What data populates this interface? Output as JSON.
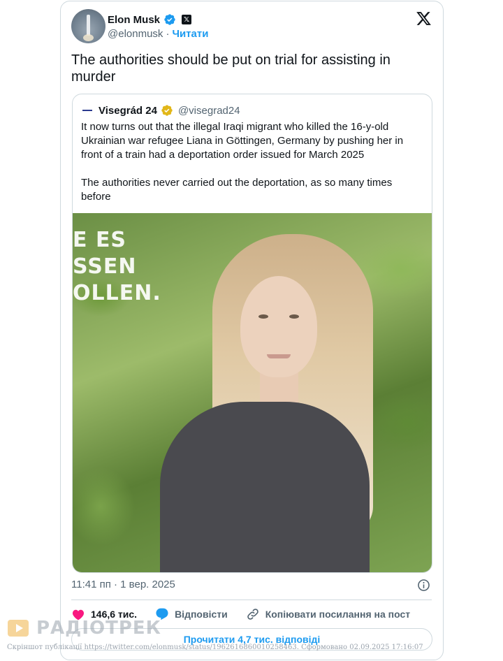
{
  "tweet": {
    "author_name": "Elon Musk",
    "author_handle": "@elonmusk",
    "separator": "·",
    "follow_label": "Читати",
    "x_badge": "𝕏",
    "text": "The authorities should be put on trial for assisting in murder",
    "timestamp": "11:41 пп · 1 вер. 2025"
  },
  "quoted": {
    "name": "Visegrád 24",
    "handle": "@visegrad24",
    "text": "It now turns out that the illegal Iraqi migrant who killed the 16-y-old Ukrainian war refugee Liana in Göttingen, Germany by pushing her in front of a train had a deportation order issued for March 2025\n\nThe authorities never carried out the deportation, as so many times before",
    "image_overlay_text": [
      "E ES",
      "SSEN",
      "OLLEN."
    ]
  },
  "actions": {
    "likes": "146,6 тис.",
    "reply": "Відповісти",
    "copy_link": "Копіювати посилання на пост"
  },
  "read_replies": "Прочитати 4,7 тис. відповіді",
  "watermark": {
    "logo_text": "РАДІОТРЕК",
    "caption": "Скріншот публікації https://twitter.com/elonmusk/status/1962616860010258463. Сформовано 02.09.2025 17:16:07"
  },
  "colors": {
    "accent": "#1d9bf0",
    "like": "#f91880",
    "gold_badge": "#e2b719"
  },
  "icons": [
    "verified-badge-icon",
    "x-logo-icon",
    "gold-verified-icon",
    "info-icon",
    "heart-icon",
    "reply-bubble-icon",
    "link-icon"
  ]
}
